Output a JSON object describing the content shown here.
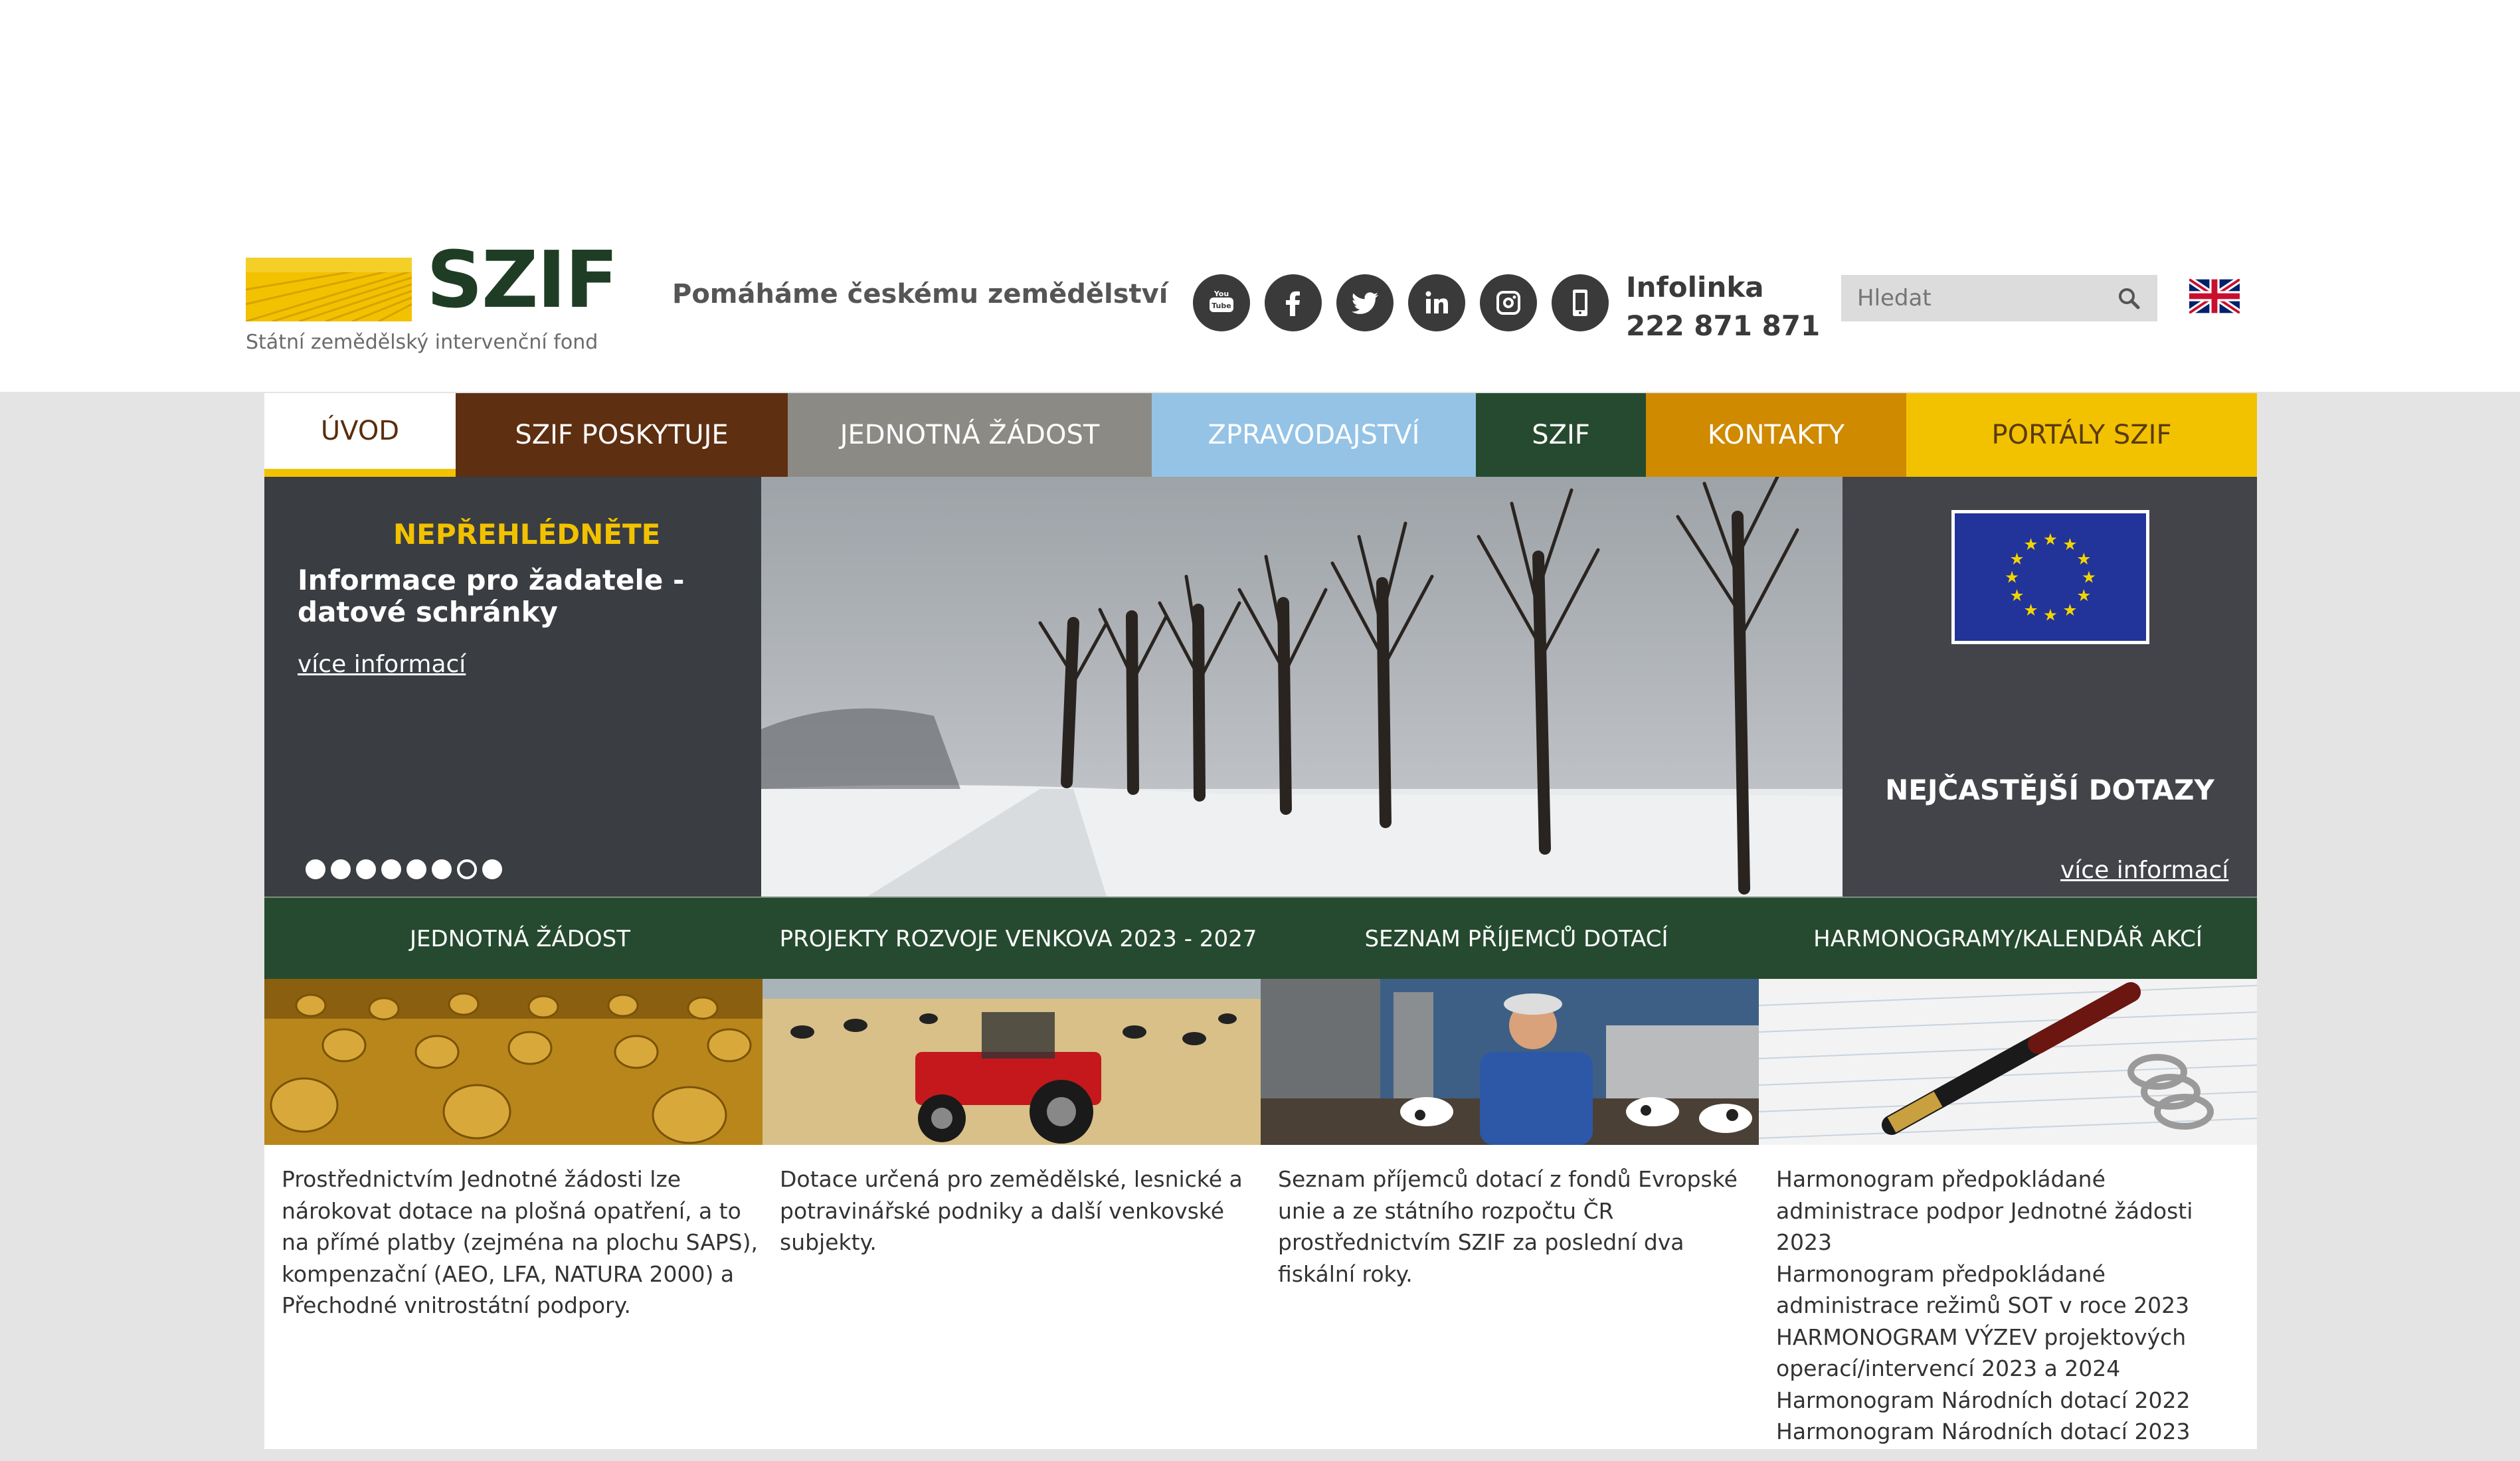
{
  "header": {
    "logo_name": "SZIF",
    "logo_subtitle": "Státní zemědělský intervenční fond",
    "slogan": "Pomáháme českému zemědělství",
    "social_icons": [
      "youtube-icon",
      "facebook-icon",
      "twitter-icon",
      "linkedin-icon",
      "instagram-icon",
      "mobile-icon"
    ],
    "infolinka_label": "Infolinka",
    "infolinka_number": "222 871 871",
    "search_placeholder": "Hledat",
    "language_flag": "uk-flag-icon"
  },
  "nav": {
    "items": [
      {
        "label": "ÚVOD",
        "color": "#ffffff"
      },
      {
        "label": "SZIF POSKYTUJE",
        "color": "#5e2f10"
      },
      {
        "label": "JEDNOTNÁ ŽÁDOST",
        "color": "#8c8a85"
      },
      {
        "label": "ZPRAVODAJSTVÍ",
        "color": "#94c3e6"
      },
      {
        "label": "SZIF",
        "color": "#264a2f"
      },
      {
        "label": "KONTAKTY",
        "color": "#cf8a00"
      },
      {
        "label": "PORTÁLY SZIF",
        "color": "#f2c200"
      }
    ]
  },
  "hero": {
    "notice_title": "NEPŘEHLÉDNĚTE",
    "notice_text": "Informace pro žadatele - datové schránky",
    "notice_link": "více informací",
    "slide_count": 8,
    "current_slide": 7,
    "faq_title": "NEJČASTĚJŠÍ DOTAZY",
    "faq_link": "více informací"
  },
  "quicklinks": [
    {
      "label": "JEDNOTNÁ ŽÁDOST",
      "text": "Prostřednictvím Jednotné žádosti lze nárokovat dotace na plošná opatření, a to na přímé platby (zejména na plochu SAPS), kompenzační (AEO, LFA, NATURA 2000) a Přechodné vnitrostátní podpory."
    },
    {
      "label": "PROJEKTY ROZVOJE VENKOVA 2023 - 2027",
      "text": "Dotace určená pro zemědělské, lesnické a potravinářské podniky a další venkovské subjekty."
    },
    {
      "label": "SEZNAM PŘÍJEMCŮ DOTACÍ",
      "text": "Seznam příjemců dotací z fondů Evropské unie a ze státního rozpočtu ČR prostřednictvím SZIF za poslední dva fiskální roky."
    },
    {
      "label": "HARMONOGRAMY/KALENDÁŘ AKCÍ",
      "links": [
        "Harmonogram předpokládané administrace podpor Jednotné žádosti 2023",
        "Harmonogram předpokládané administrace režimů SOT v roce 2023",
        "HARMONOGRAM VÝZEV projektových operací/intervencí 2023 a 2024",
        "Harmonogram Národních dotací 2022",
        "Harmonogram Národních dotací 2023"
      ]
    }
  ]
}
